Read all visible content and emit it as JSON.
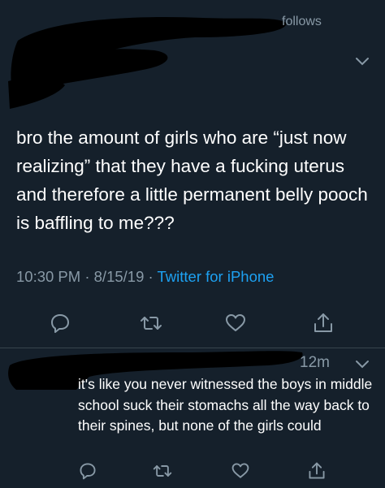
{
  "tweet": {
    "follows_label": "follows",
    "text": "bro the amount of girls who are “just now realizing” that they have a fucking uterus and therefore a little permanent belly pooch is baffling to me???",
    "time": "10:30 PM",
    "date": "8/15/19",
    "separator": "·",
    "source": "Twitter for iPhone"
  },
  "reply": {
    "time": "12m",
    "text": "it's like you never witnessed the boys in middle school suck their stomachs all the way back to their spines, but none of the girls could"
  },
  "icons": {
    "reply": "reply-icon",
    "retweet": "retweet-icon",
    "like": "heart-icon",
    "share": "share-icon",
    "more": "chevron-down-icon"
  },
  "colors": {
    "background": "#15202b",
    "text": "#ffffff",
    "secondary_text": "#8899a6",
    "link": "#1da1f2",
    "divider": "#38444d"
  }
}
